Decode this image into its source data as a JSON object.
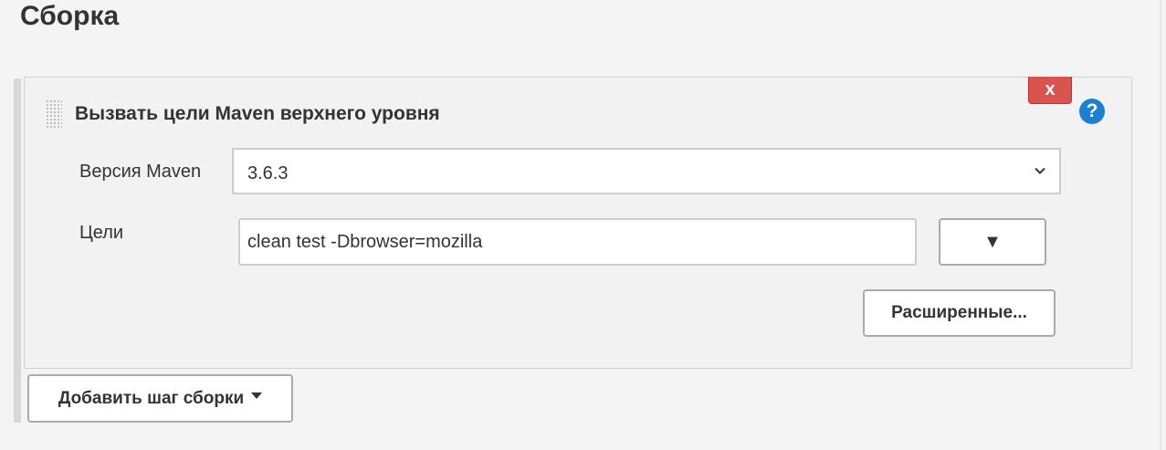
{
  "section": {
    "title": "Сборка"
  },
  "build_step": {
    "title": "Вызвать цели Maven верхнего уровня",
    "delete_label": "x",
    "help_label": "?",
    "maven_version": {
      "label": "Версия Maven",
      "selected": "3.6.3"
    },
    "goals": {
      "label": "Цели",
      "value": "clean test -Dbrowser=mozilla",
      "expand_label": "▼"
    },
    "advanced_label": "Расширенные..."
  },
  "add_step": {
    "label": "Добавить шаг сборки"
  },
  "icons": {
    "drag": "drag-handle-icon",
    "help": "help-icon",
    "delete": "close-icon",
    "chevron": "chevron-down-icon",
    "caret": "caret-down-icon"
  },
  "colors": {
    "delete_button": "#d9534f",
    "help_icon": "#1d7fd1",
    "panel_background": "#f2f2f2"
  }
}
